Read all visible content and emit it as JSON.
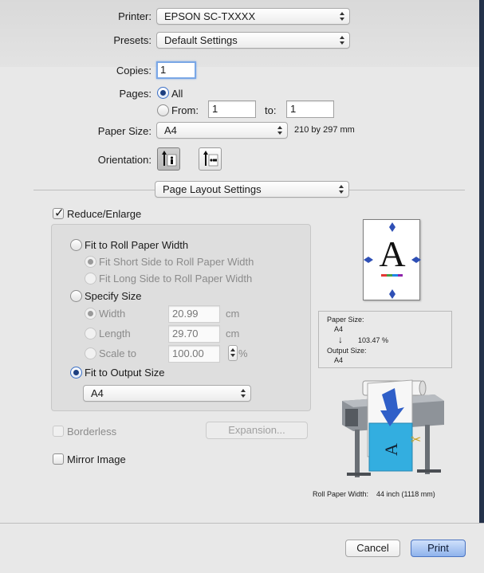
{
  "printer": {
    "label": "Printer:",
    "value": "EPSON SC-TXXXX"
  },
  "presets": {
    "label": "Presets:",
    "value": "Default Settings"
  },
  "copies": {
    "label": "Copies:",
    "value": "1"
  },
  "pages": {
    "label": "Pages:",
    "all_label": "All",
    "from_label": "From:",
    "from_value": "1",
    "to_label": "to:",
    "to_value": "1"
  },
  "paper_size": {
    "label": "Paper Size:",
    "value": "A4",
    "dimensions": "210 by 297 mm"
  },
  "orientation": {
    "label": "Orientation:"
  },
  "panel": {
    "value": "Page Layout Settings"
  },
  "reduce_enlarge": {
    "label": "Reduce/Enlarge",
    "checked": true
  },
  "fit_roll": {
    "label": "Fit to Roll Paper Width",
    "short_side": "Fit Short Side to Roll Paper Width",
    "long_side": "Fit Long Side to Roll Paper Width"
  },
  "specify_size": {
    "label": "Specify Size",
    "width_label": "Width",
    "width_value": "20.99",
    "width_unit": "cm",
    "length_label": "Length",
    "length_value": "29.70",
    "length_unit": "cm",
    "scale_label": "Scale to",
    "scale_value": "100.00",
    "scale_unit": "%"
  },
  "fit_output": {
    "label": "Fit to Output Size",
    "value": "A4"
  },
  "borderless": {
    "label": "Borderless"
  },
  "expansion": {
    "label": "Expansion..."
  },
  "mirror": {
    "label": "Mirror Image"
  },
  "preview": {
    "letter": "A"
  },
  "info": {
    "paper_size_label": "Paper Size:",
    "paper_size_value": "A4",
    "scale": "103.47  %",
    "output_size_label": "Output Size:",
    "output_size_value": "A4"
  },
  "roll_width": {
    "label": "Roll Paper Width:",
    "value": "44 inch (1118 mm)"
  },
  "buttons": {
    "cancel": "Cancel",
    "print": "Print"
  },
  "colors": {
    "accent": "#3b6fc6",
    "print_button": "#8fb3ec",
    "preview_arrow": "#2e4fb5"
  }
}
